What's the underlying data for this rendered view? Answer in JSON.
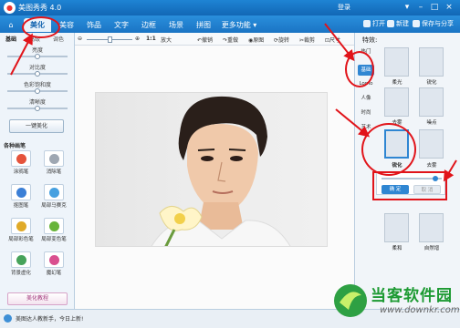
{
  "app": {
    "title": "美图秀秀 4.0",
    "login": "登录"
  },
  "tabs": [
    {
      "label": "美化",
      "active": true
    },
    {
      "label": "美容"
    },
    {
      "label": "饰品"
    },
    {
      "label": "文字"
    },
    {
      "label": "边框"
    },
    {
      "label": "场景"
    },
    {
      "label": "拼图"
    },
    {
      "label": "更多功能 ▾"
    }
  ],
  "top_right": {
    "open": "打开",
    "new": "新建",
    "save": "保存与分享"
  },
  "left": {
    "subtabs": [
      "基础",
      "高级",
      "调色"
    ],
    "sliders": [
      {
        "label": "亮度",
        "level": 0.5
      },
      {
        "label": "对比度",
        "level": 0.5
      },
      {
        "label": "色彩饱和度",
        "level": 0.5
      },
      {
        "label": "清晰度",
        "level": 0.5
      }
    ],
    "one_key": "一键美化",
    "brush_title": "各种画笔",
    "brushes": [
      {
        "label": "涂鸦笔",
        "icon": "doodle-pen-icon",
        "color": "#e5533b"
      },
      {
        "label": "消除笔",
        "icon": "eraser-pen-icon",
        "color": "#9ea7b2"
      },
      {
        "label": "抠图笔",
        "icon": "cutout-pen-icon",
        "color": "#3b7fd6"
      },
      {
        "label": "局部马赛克",
        "icon": "mosaic-icon",
        "color": "#46a0e0"
      },
      {
        "label": "局部彩色笔",
        "icon": "color-pen-icon",
        "color": "#e0aa28"
      },
      {
        "label": "局部变色笔",
        "icon": "recolor-pen-icon",
        "color": "#67b43a"
      },
      {
        "label": "背景虚化",
        "icon": "blur-background-icon",
        "color": "#47a35a"
      },
      {
        "label": "魔幻笔",
        "icon": "magic-pen-icon",
        "color": "#d94f8f"
      }
    ],
    "tutorial": "美化教程"
  },
  "toolbar": {
    "zoom_ratio": "1:1",
    "enlarge": "放大",
    "rotate": "旋转",
    "crop": "裁剪",
    "resize": "尺寸",
    "undo": "撤销",
    "redo": "重做",
    "original": "原图",
    "compare": "对比"
  },
  "right": {
    "title": "特效:",
    "nav": [
      "热门",
      "基础",
      "Lomo",
      "人像",
      "时尚",
      "艺术"
    ],
    "nav_active": 1,
    "effects": [
      "柔光",
      "锐化",
      "去雾",
      "噪点",
      "锐化",
      "去雾",
      "柔和",
      "自然增"
    ],
    "confirm": "确 定",
    "cancel": "取 消"
  },
  "status": {
    "text": "美图达人教新手，今日上新!"
  },
  "watermark": {
    "title": "当客软件园",
    "url": "www.downkr.com"
  },
  "accent_colors": {
    "brand_blue": "#1a74c4",
    "annotation_red": "#e1141a",
    "watermark_green": "#1c9a32"
  }
}
